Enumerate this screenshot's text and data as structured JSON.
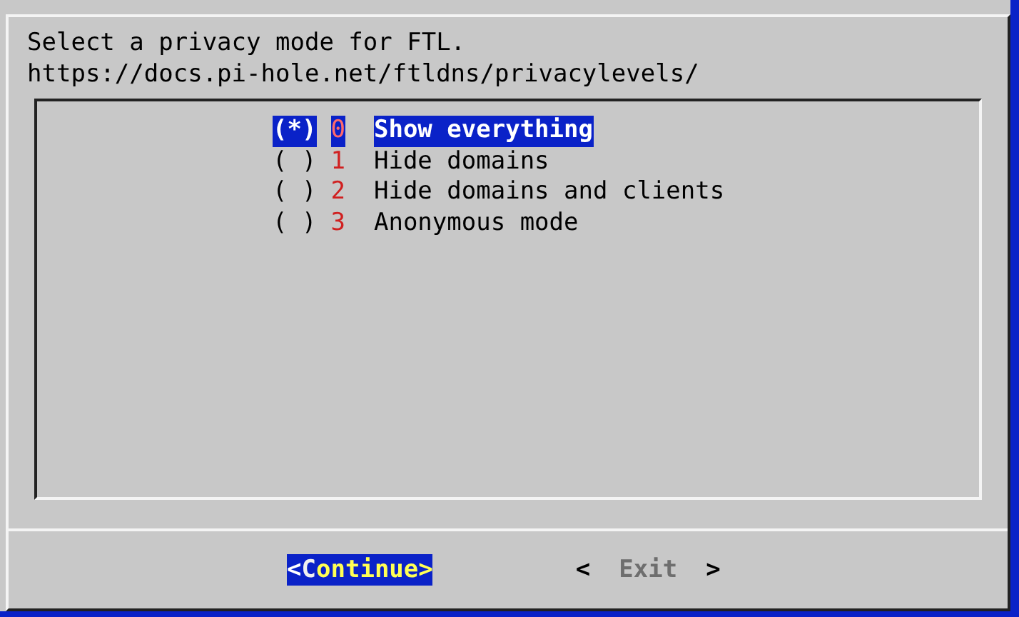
{
  "dialog": {
    "prompt_lines": [
      "Select a privacy mode for FTL.",
      "https://docs.pi-hole.net/ftldns/privacylevels/"
    ],
    "options": [
      {
        "marker": "(*)",
        "number": "0",
        "label": "Show everything",
        "selected": true
      },
      {
        "marker": "( )",
        "number": "1",
        "label": "Hide domains",
        "selected": false
      },
      {
        "marker": "( )",
        "number": "2",
        "label": "Hide domains and clients",
        "selected": false
      },
      {
        "marker": "( )",
        "number": "3",
        "label": "Anonymous mode",
        "selected": false
      }
    ],
    "buttons": [
      {
        "open": "<",
        "label": "Continue",
        "close": ">",
        "selected": true
      },
      {
        "open": "<",
        "label": "Exit",
        "close": ">",
        "selected": false
      }
    ]
  }
}
